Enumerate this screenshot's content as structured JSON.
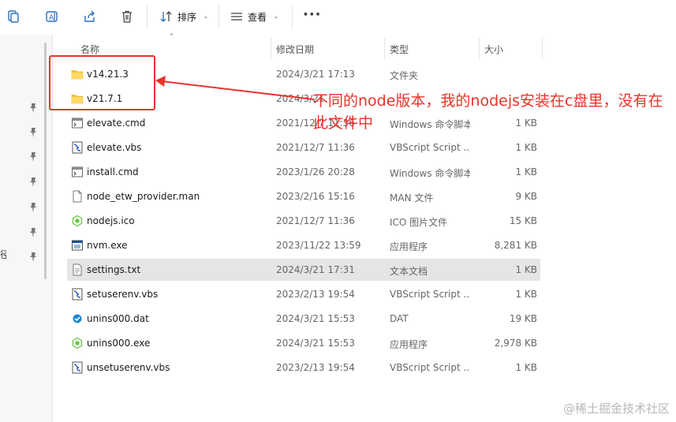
{
  "toolbar": {
    "sort_label": "排序",
    "view_label": "查看",
    "more_label": "···"
  },
  "columns": {
    "name": "名称",
    "date": "修改日期",
    "type": "类型",
    "size": "大小"
  },
  "nav": {
    "fragment": "径"
  },
  "files": [
    {
      "name": "v14.21.3",
      "date": "2024/3/21 17:13",
      "type": "文件夹",
      "size": "",
      "icon": "folder-icon"
    },
    {
      "name": "v21.7.1",
      "date": "2024/3/21",
      "type": "",
      "size": "",
      "icon": "folder-icon"
    },
    {
      "name": "elevate.cmd",
      "date": "2021/12/7 11:36",
      "type": "Windows 命令脚本",
      "size": "1 KB",
      "icon": "cmd-file-icon"
    },
    {
      "name": "elevate.vbs",
      "date": "2021/12/7 11:36",
      "type": "VBScript Script ...",
      "size": "1 KB",
      "icon": "vbs-file-icon"
    },
    {
      "name": "install.cmd",
      "date": "2023/1/26 20:28",
      "type": "Windows 命令脚本",
      "size": "1 KB",
      "icon": "cmd-file-icon"
    },
    {
      "name": "node_etw_provider.man",
      "date": "2023/2/16 15:16",
      "type": "MAN 文件",
      "size": "9 KB",
      "icon": "generic-file-icon"
    },
    {
      "name": "nodejs.ico",
      "date": "2021/12/7 11:36",
      "type": "ICO 图片文件",
      "size": "15 KB",
      "icon": "nodejs-icon"
    },
    {
      "name": "nvm.exe",
      "date": "2023/11/22 13:59",
      "type": "应用程序",
      "size": "8,281 KB",
      "icon": "exe-icon"
    },
    {
      "name": "settings.txt",
      "date": "2024/3/21 17:31",
      "type": "文本文档",
      "size": "1 KB",
      "icon": "text-file-icon"
    },
    {
      "name": "setuserenv.vbs",
      "date": "2023/2/13 19:54",
      "type": "VBScript Script ...",
      "size": "1 KB",
      "icon": "vbs-file-icon"
    },
    {
      "name": "unins000.dat",
      "date": "2024/3/21 15:53",
      "type": "DAT",
      "size": "19 KB",
      "icon": "dat-file-icon"
    },
    {
      "name": "unins000.exe",
      "date": "2024/3/21 15:53",
      "type": "应用程序",
      "size": "2,978 KB",
      "icon": "nodejs-icon"
    },
    {
      "name": "unsetuserenv.vbs",
      "date": "2023/2/13 19:54",
      "type": "VBScript Script ...",
      "size": "1 KB",
      "icon": "vbs-file-icon"
    }
  ],
  "annotation": {
    "text": "不同的node版本，我的nodejs安装在c盘里，没有在此文件中",
    "color": "#e8332a"
  },
  "watermark": "@稀土掘金技术社区"
}
